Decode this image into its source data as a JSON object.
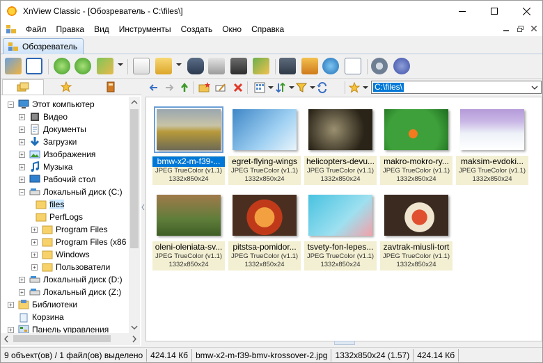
{
  "window": {
    "title": "XnView Classic - [Обозреватель - C:\\files\\]",
    "controls": {
      "minimize": "—",
      "maximize": "☐",
      "close": "✕"
    }
  },
  "menu": {
    "items": [
      "Файл",
      "Правка",
      "Вид",
      "Инструменты",
      "Создать",
      "Окно",
      "Справка"
    ]
  },
  "tab": {
    "label": "Обозреватель"
  },
  "path": {
    "value": "C:\\files\\"
  },
  "tree": {
    "nodes": [
      {
        "label": "Этот компьютер",
        "icon": "computer-icon"
      },
      {
        "label": "Видео",
        "icon": "video-folder-icon"
      },
      {
        "label": "Документы",
        "icon": "documents-folder-icon"
      },
      {
        "label": "Загрузки",
        "icon": "downloads-folder-icon"
      },
      {
        "label": "Изображения",
        "icon": "pictures-folder-icon"
      },
      {
        "label": "Музыка",
        "icon": "music-folder-icon"
      },
      {
        "label": "Рабочий стол",
        "icon": "desktop-folder-icon"
      },
      {
        "label": "Локальный диск (C:)",
        "icon": "drive-icon"
      },
      {
        "label": "files",
        "icon": "folder-icon"
      },
      {
        "label": "PerfLogs",
        "icon": "folder-icon"
      },
      {
        "label": "Program Files",
        "icon": "folder-icon"
      },
      {
        "label": "Program Files (x86",
        "icon": "folder-icon"
      },
      {
        "label": "Windows",
        "icon": "folder-icon"
      },
      {
        "label": "Пользователи",
        "icon": "folder-icon"
      },
      {
        "label": "Локальный диск (D:)",
        "icon": "drive-icon"
      },
      {
        "label": "Локальный диск (Z:)",
        "icon": "drive-icon"
      },
      {
        "label": "Библиотеки",
        "icon": "libraries-icon"
      },
      {
        "label": "Корзина",
        "icon": "recycle-bin-icon"
      },
      {
        "label": "Панель управления",
        "icon": "control-panel-icon"
      }
    ]
  },
  "thumbnails": [
    {
      "name": "bmw-x2-m-f39-...",
      "format": "JPEG TrueColor (v1.1)",
      "dims": "1332x850x24"
    },
    {
      "name": "egret-flying-wings",
      "format": "JPEG TrueColor (v1.1)",
      "dims": "1332x850x24"
    },
    {
      "name": "helicopters-devu...",
      "format": "JPEG TrueColor (v1.1)",
      "dims": "1332x850x24"
    },
    {
      "name": "makro-mokro-ry...",
      "format": "JPEG TrueColor (v1.1)",
      "dims": "1332x850x24"
    },
    {
      "name": "maksim-evdoki...",
      "format": "JPEG TrueColor (v1.1)",
      "dims": "1332x850x24"
    },
    {
      "name": "oleni-oleniata-sv...",
      "format": "JPEG TrueColor (v1.1)",
      "dims": "1332x850x24"
    },
    {
      "name": "pitstsa-pomidor...",
      "format": "JPEG TrueColor (v1.1)",
      "dims": "1332x850x24"
    },
    {
      "name": "tsvety-fon-lepes...",
      "format": "JPEG TrueColor (v1.1)",
      "dims": "1332x850x24"
    },
    {
      "name": "zavtrak-miusli-tort",
      "format": "JPEG TrueColor (v1.1)",
      "dims": "1332x850x24"
    }
  ],
  "status": {
    "selection": "9 объект(ов) / 1 файл(ов) выделено",
    "size": "424.14 Кб",
    "filename": "bmw-x2-m-f39-bmv-krossover-2.jpg",
    "dims": "1332x850x24 (1.57)",
    "filesize": "424.14 Кб"
  }
}
